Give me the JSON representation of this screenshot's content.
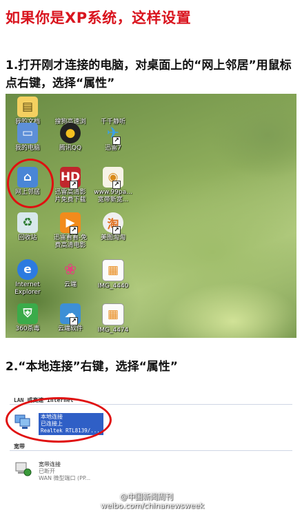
{
  "title": "如果你是XP系统，这样设置",
  "step1": "1.打开刚才连接的电脑，对桌面上的“网上邻居”用鼠标点右键，选择“属性”",
  "step2": "2.“本地连接”右键，选择“属性”",
  "desktop": {
    "icons": [
      {
        "label": "我的文档",
        "icon": "my-documents-icon"
      },
      {
        "label": "搜狗高速浏\n览器",
        "icon": "sogou-browser-icon"
      },
      {
        "label": "千千静听",
        "icon": "ttplayer-icon"
      },
      {
        "label": "我的电脑",
        "icon": "my-computer-icon"
      },
      {
        "label": "腾讯QQ",
        "icon": "qq-penguin-icon"
      },
      {
        "label": "迅雷7",
        "icon": "thunder-bird-icon"
      },
      {
        "label": "网上邻居",
        "icon": "network-places-icon"
      },
      {
        "label": "迅雷高清影\n片免费下载",
        "icon": "hd-movie-icon"
      },
      {
        "label": "www.99pa...\n宽带新宽...",
        "icon": "web-shortcut-icon"
      },
      {
        "label": "回收站",
        "icon": "recycle-bin-icon"
      },
      {
        "label": "迅雷看看-免\n费高清电影",
        "icon": "kankan-icon"
      },
      {
        "label": "美图淘淘",
        "icon": "meitu-icon"
      },
      {
        "label": "Internet\nExplorer",
        "icon": "ie-icon"
      },
      {
        "label": "云端",
        "icon": "cloud-icon"
      },
      {
        "label": "IMG_4440",
        "icon": "image-file-icon"
      },
      {
        "label": "360杀毒",
        "icon": "antivirus-shield-icon"
      },
      {
        "label": "云端软件",
        "icon": "cloud-software-icon"
      },
      {
        "label": "IMG_4474",
        "icon": "image-file-icon"
      }
    ]
  },
  "network": {
    "group1": "LAN 或高速 Internet",
    "lan_name": "本地连接",
    "lan_status": "已连接上",
    "lan_device": "Realtek RTL8139/...",
    "group2": "宽带",
    "bb_name": "宽带连接",
    "bb_status": "已断开",
    "bb_device": "WAN 微型端口 (PP..."
  },
  "watermark": {
    "account": "@中国新闻周刊",
    "url": "weibo.com/chinanewsweek"
  }
}
